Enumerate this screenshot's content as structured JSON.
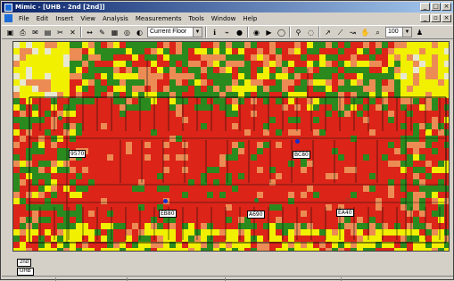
{
  "window": {
    "title": "Mimic - [UHB - 2nd [2nd]]"
  },
  "menu": [
    "File",
    "Edit",
    "Insert",
    "View",
    "Analysis",
    "Measurements",
    "Tools",
    "Window",
    "Help"
  ],
  "toolbar": {
    "floor_combo": "Current Floor",
    "zoom_combo": "100"
  },
  "labels": {
    "l1": "9570",
    "l2": "BC80",
    "l3": "EB80",
    "l4": "A690",
    "l5": "EA40"
  },
  "tabs": {
    "floor": "2nd",
    "building": "UHB"
  },
  "colors": {
    "strong": "#dc2418",
    "good": "#ec8c54",
    "fair": "#2a8a1e",
    "weak": "#f0f000",
    "none": "#e8e8d0"
  }
}
